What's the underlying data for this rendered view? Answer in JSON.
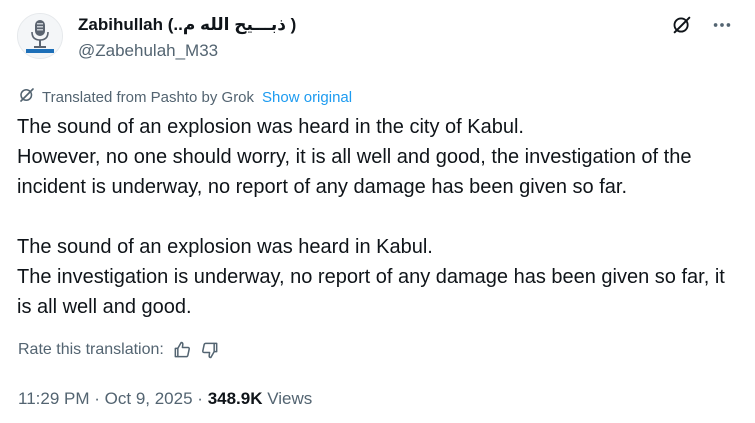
{
  "author": {
    "name": "Zabihullah (..ذبـــيح الله م )",
    "handle": "@Zabehulah_M33"
  },
  "translation": {
    "label": "Translated from Pashto by Grok",
    "show_original": "Show original"
  },
  "tweet": {
    "paragraph1": [
      "The sound of an explosion was heard in the city of Kabul.",
      "However, no one should worry, it is all well and good, the investigation of the incident is underway, no report of any damage has been given so far."
    ],
    "paragraph2": [
      "The sound of an explosion was heard in Kabul.",
      "The investigation is underway, no report of any damage has been given so far, it is all well and good."
    ]
  },
  "rate": {
    "label": "Rate this translation:"
  },
  "meta": {
    "time": "11:29 PM",
    "separator": "·",
    "date": "Oct 9, 2025",
    "views_count": "348.9K",
    "views_label": "Views"
  },
  "icons": {
    "grok": "grok-icon",
    "more": "more-icon",
    "translate": "grok-translate-icon",
    "thumbs_up": "thumbs-up-icon",
    "thumbs_down": "thumbs-down-icon"
  },
  "colors": {
    "text": "#0f1419",
    "secondary": "#536471",
    "link": "#1d9bf0"
  }
}
